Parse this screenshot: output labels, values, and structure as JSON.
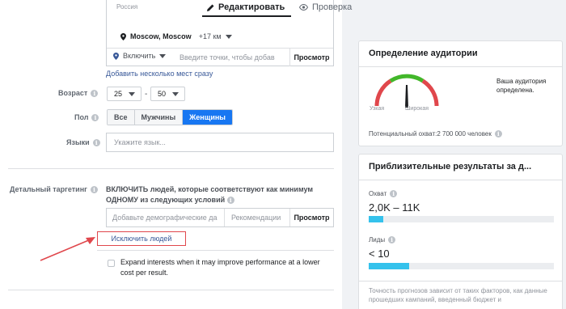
{
  "tabs": {
    "edit_label": "Редактировать",
    "review_label": "Проверка"
  },
  "location": {
    "country": "Россия",
    "city": "Moscow, Moscow",
    "radius": "+17 км",
    "include_label": "Включить",
    "input_placeholder": "Введите точки, чтобы добав",
    "browse_label": "Просмотр",
    "bulk_link": "Добавить несколько мест сразу"
  },
  "age": {
    "label": "Возраст",
    "min": "25",
    "max": "50"
  },
  "gender": {
    "label": "Пол",
    "options": [
      "Все",
      "Мужчины",
      "Женщины"
    ],
    "selected": "Женщины"
  },
  "languages": {
    "label": "Языки",
    "placeholder": "Укажите язык..."
  },
  "detailed_targeting": {
    "label": "Детальный таргетинг",
    "description": "ВКЛЮЧИТЬ людей, которые соответствуют как минимум ОДНОМУ из следующих условий",
    "input_placeholder": "Добавьте демографические да",
    "recommendations_label": "Рекомендации",
    "browse_label": "Просмотр",
    "exclude_link": "Исключить людей",
    "expand_checkbox_label": "Expand interests when it may improve performance at a lower cost per result.",
    "expand_checked": false
  },
  "audience_definition": {
    "title": "Определение аудитории",
    "gauge_left": "Узкая",
    "gauge_right": "Широкая",
    "note": "Ваша аудитория определена.",
    "potential_reach": "Потенциальный охват:2 700 000 человек"
  },
  "estimated_results": {
    "title": "Приблизительные результаты за д...",
    "reach_label": "Охват",
    "reach_value": "2,0K – 11K",
    "reach_fill": 0.08,
    "leads_label": "Лиды",
    "leads_value": "< 10",
    "leads_fill": 0.22,
    "footer": "Точность прогнозов зависит от таких факторов, как данные прошедших кампаний, введенный бюджет и"
  },
  "colors": {
    "accent": "#1877f2",
    "link": "#385898",
    "highlight": "#e0474c",
    "bar_fill": "#35c2ec"
  }
}
